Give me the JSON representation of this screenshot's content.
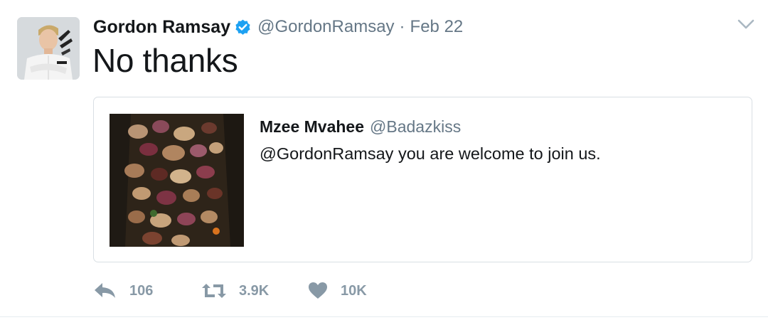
{
  "tweet": {
    "author_name": "Gordon Ramsay",
    "author_handle": "@GordonRamsay",
    "separator": "·",
    "date": "Feb 22",
    "text": "No thanks",
    "quoted": {
      "author_name": "Mzee Mvahee",
      "author_handle": "@Badazkiss",
      "text": "@GordonRamsay you are welcome to join us."
    },
    "actions": {
      "reply_count": "106",
      "retweet_count": "3.9K",
      "like_count": "10K"
    }
  },
  "colors": {
    "verified_blue": "#1da1f2",
    "secondary_text": "#657786",
    "action_gray": "#8899a6"
  },
  "icons": {
    "verified": "verified-badge-icon",
    "caret": "chevron-down-icon",
    "reply": "reply-icon",
    "retweet": "retweet-icon",
    "like": "heart-icon"
  }
}
